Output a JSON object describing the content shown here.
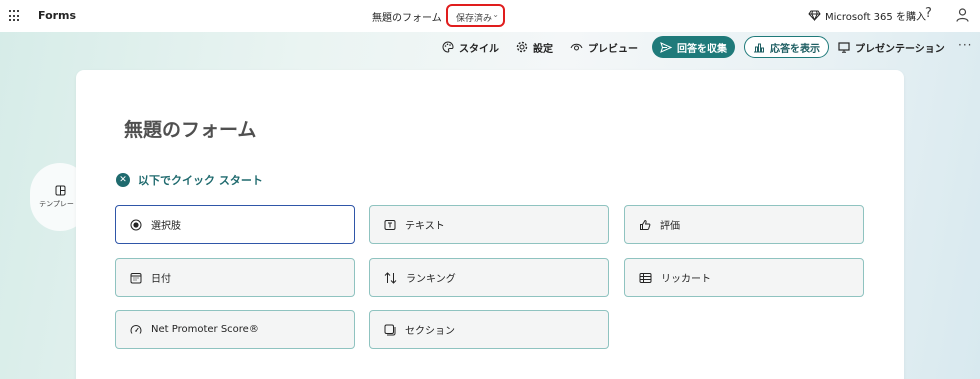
{
  "topbar": {
    "app_name": "Forms",
    "doc_title": "無題のフォーム",
    "save_status": "保存済み",
    "buy_label": "Microsoft 365 を購入",
    "help_icon": "question-mark-icon",
    "account_icon": "person-icon"
  },
  "commands": {
    "style": "スタイル",
    "settings": "設定",
    "preview": "プレビュー",
    "collect": "回答を収集",
    "responses": "応答を表示",
    "present": "プレゼンテーション"
  },
  "templates_label": "テンプレート",
  "form": {
    "title": "無題のフォーム",
    "quick_start": "以下でクイック スタート",
    "options": [
      {
        "label": "選択肢",
        "icon": "radio-icon"
      },
      {
        "label": "テキスト",
        "icon": "text-box-icon"
      },
      {
        "label": "評価",
        "icon": "thumb-up-icon"
      },
      {
        "label": "日付",
        "icon": "calendar-icon"
      },
      {
        "label": "ランキング",
        "icon": "sort-arrows-icon"
      },
      {
        "label": "リッカート",
        "icon": "likert-table-icon"
      },
      {
        "label": "Net Promoter Score®",
        "icon": "gauge-icon"
      },
      {
        "label": "セクション",
        "icon": "section-icon"
      }
    ]
  },
  "colors": {
    "accent": "#1f7a7a",
    "highlight_border": "#e01d1d",
    "selected_border": "#2f56a8"
  }
}
